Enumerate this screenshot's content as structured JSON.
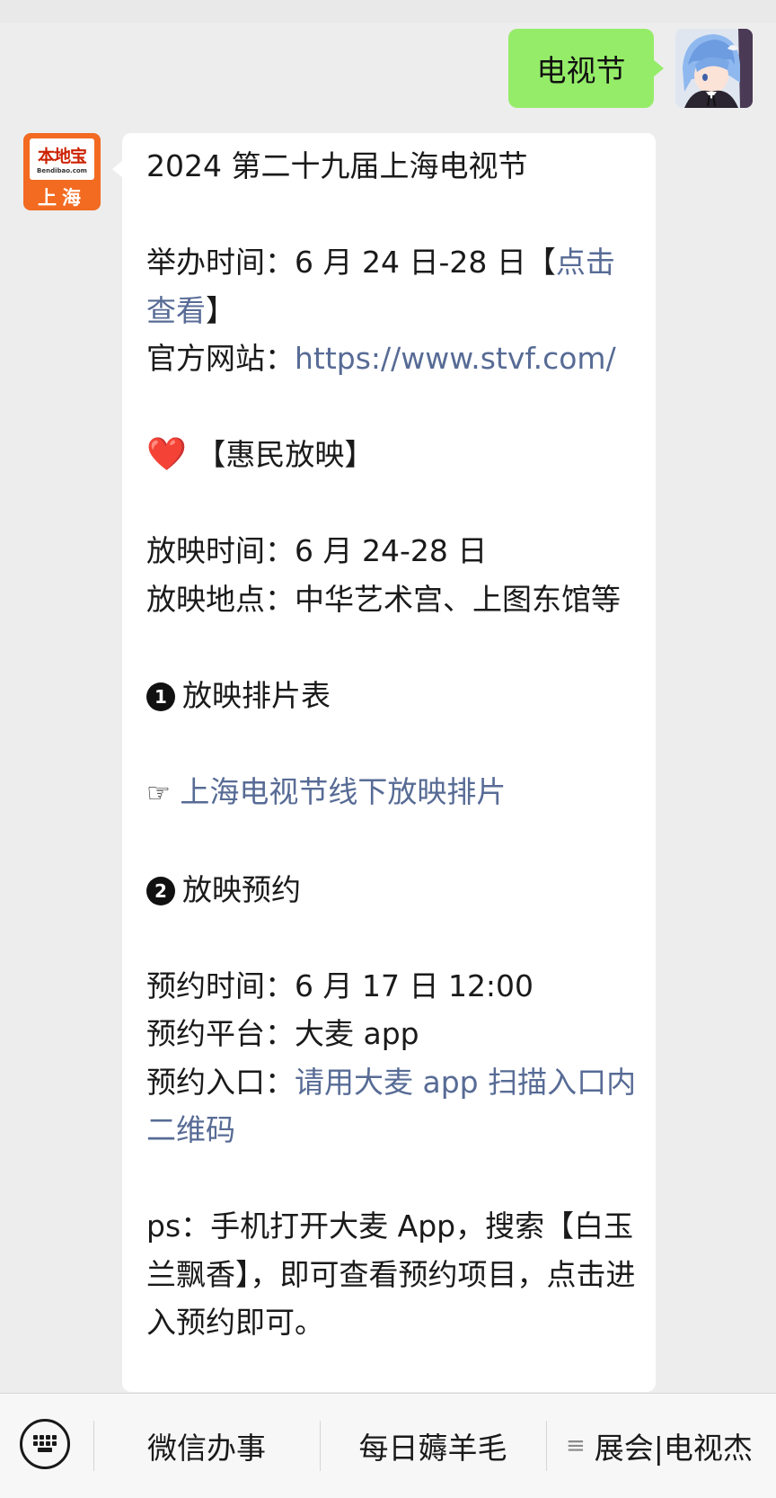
{
  "user_message": {
    "text": "电视节"
  },
  "official_account": {
    "avatar_brand": "本地宝",
    "avatar_url": "Bendibao.com",
    "avatar_city": "上海"
  },
  "reply": {
    "title": "2024 第二十九届上海电视节",
    "hold_time_label": "举办时间：",
    "hold_time_value": "6 月 24 日-28 日",
    "hold_time_bracket_open": "【",
    "hold_time_link": "点击查看",
    "hold_time_bracket_close": "】",
    "website_label": "官方网站：",
    "website_url": "https://www.stvf.com/",
    "heart": "❤️",
    "section_title": "【惠民放映】",
    "screen_time": "放映时间：6 月 24-28 日",
    "screen_place": "放映地点：中华艺术宫、上图东馆等",
    "step1_num": "1",
    "step1_title": "放映排片表",
    "schedule_hand": "☞",
    "schedule_link": "上海电视节线下放映排片",
    "step2_num": "2",
    "step2_title": "放映预约",
    "booking_time": "预约时间：6 月 17 日 12:00",
    "booking_platform": "预约平台：大麦 app",
    "booking_entry_label": "预约入口：",
    "booking_entry_link": "请用大麦 app 扫描入口内二维码",
    "ps": "ps：手机打开大麦 App，搜索【白玉兰飘香】，即可查看预约项目，点击进入预约即可。"
  },
  "bottom_menu": {
    "items": [
      "微信办事",
      "每日薅羊毛",
      "展会|电视杰"
    ],
    "menu_glyph": "≡"
  }
}
